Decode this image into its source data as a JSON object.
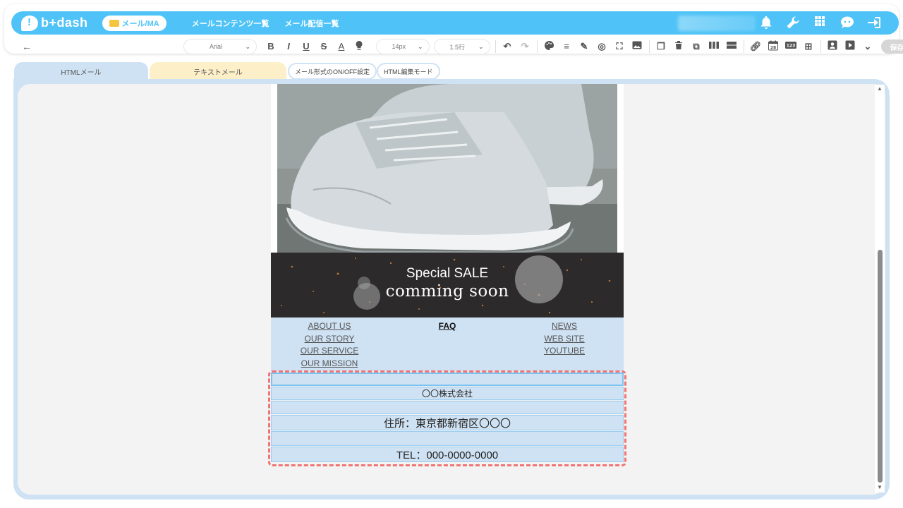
{
  "header": {
    "logo_text": "b+dash",
    "mode_pill": "メール/MA",
    "nav_links": [
      "メールコンテンツ一覧",
      "メール配信一覧"
    ]
  },
  "toolbar": {
    "font_family": "Arial",
    "font_size": "14px",
    "line_height": "1.5行",
    "save_label": "保存"
  },
  "tabs": {
    "html_mail": "HTMLメール",
    "text_mail": "テキストメール",
    "format_toggle": "メール形式のON/OFF設定",
    "html_edit_mode": "HTML編集モード"
  },
  "email": {
    "banner_line1": "Special SALE",
    "banner_line2": "comming soon",
    "links_col1": [
      "ABOUT US",
      "OUR STORY",
      "OUR SERVICE",
      "OUR MISSION"
    ],
    "links_col2": [
      "FAQ"
    ],
    "links_col3": [
      "NEWS",
      "WEB SITE",
      "YOUTUBE"
    ],
    "footer": {
      "company": "〇〇株式会社",
      "address": "住所：東京都新宿区〇〇〇",
      "tel": "TEL：000-0000-0000"
    }
  },
  "colors": {
    "header_blue": "#4fc3f7",
    "tab_blue": "#cfe2f3",
    "tab_yellow": "#fdf0c8",
    "selection_red": "#f07575"
  }
}
